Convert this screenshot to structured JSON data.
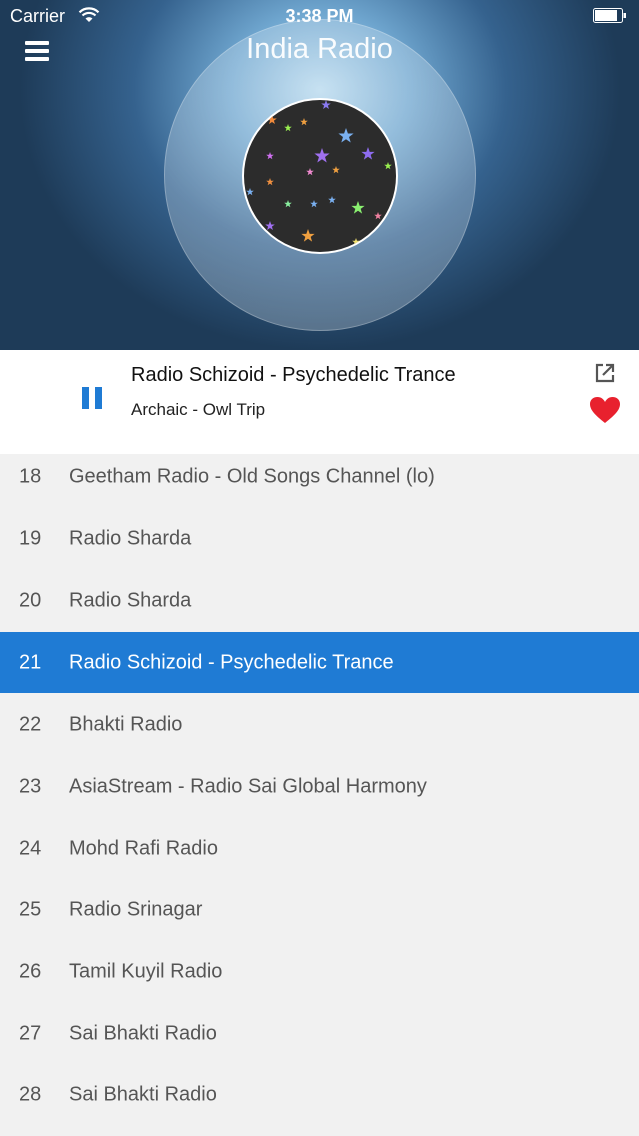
{
  "status_bar": {
    "carrier": "Carrier",
    "time": "3:38 PM"
  },
  "header": {
    "title": "India Radio",
    "menu_icon": "hamburger-menu-icon"
  },
  "now_playing": {
    "station": "Radio Schizoid - Psychedelic Trance",
    "track": "Archaic - Owl Trip",
    "state": "playing",
    "pause_icon": "pause-icon",
    "share_icon": "share-external-icon",
    "favorite_icon": "heart-icon",
    "favorite": true
  },
  "colors": {
    "accent": "#1f7bd4",
    "heart": "#e8212e",
    "list_bg": "#f1f1f1"
  },
  "stations": [
    {
      "num": "18",
      "name": "Geetham Radio - Old Songs Channel (lo)"
    },
    {
      "num": "19",
      "name": "Radio Sharda"
    },
    {
      "num": "20",
      "name": "Radio Sharda"
    },
    {
      "num": "21",
      "name": "Radio Schizoid - Psychedelic Trance",
      "selected": true
    },
    {
      "num": "22",
      "name": "Bhakti Radio"
    },
    {
      "num": "23",
      "name": "AsiaStream - Radio Sai Global Harmony"
    },
    {
      "num": "24",
      "name": "Mohd Rafi Radio"
    },
    {
      "num": "25",
      "name": "Radio Srinagar"
    },
    {
      "num": "26",
      "name": "Tamil Kuyil Radio"
    },
    {
      "num": "27",
      "name": "Sai Bhakti Radio"
    },
    {
      "num": "28",
      "name": "Sai Bhakti Radio"
    }
  ]
}
